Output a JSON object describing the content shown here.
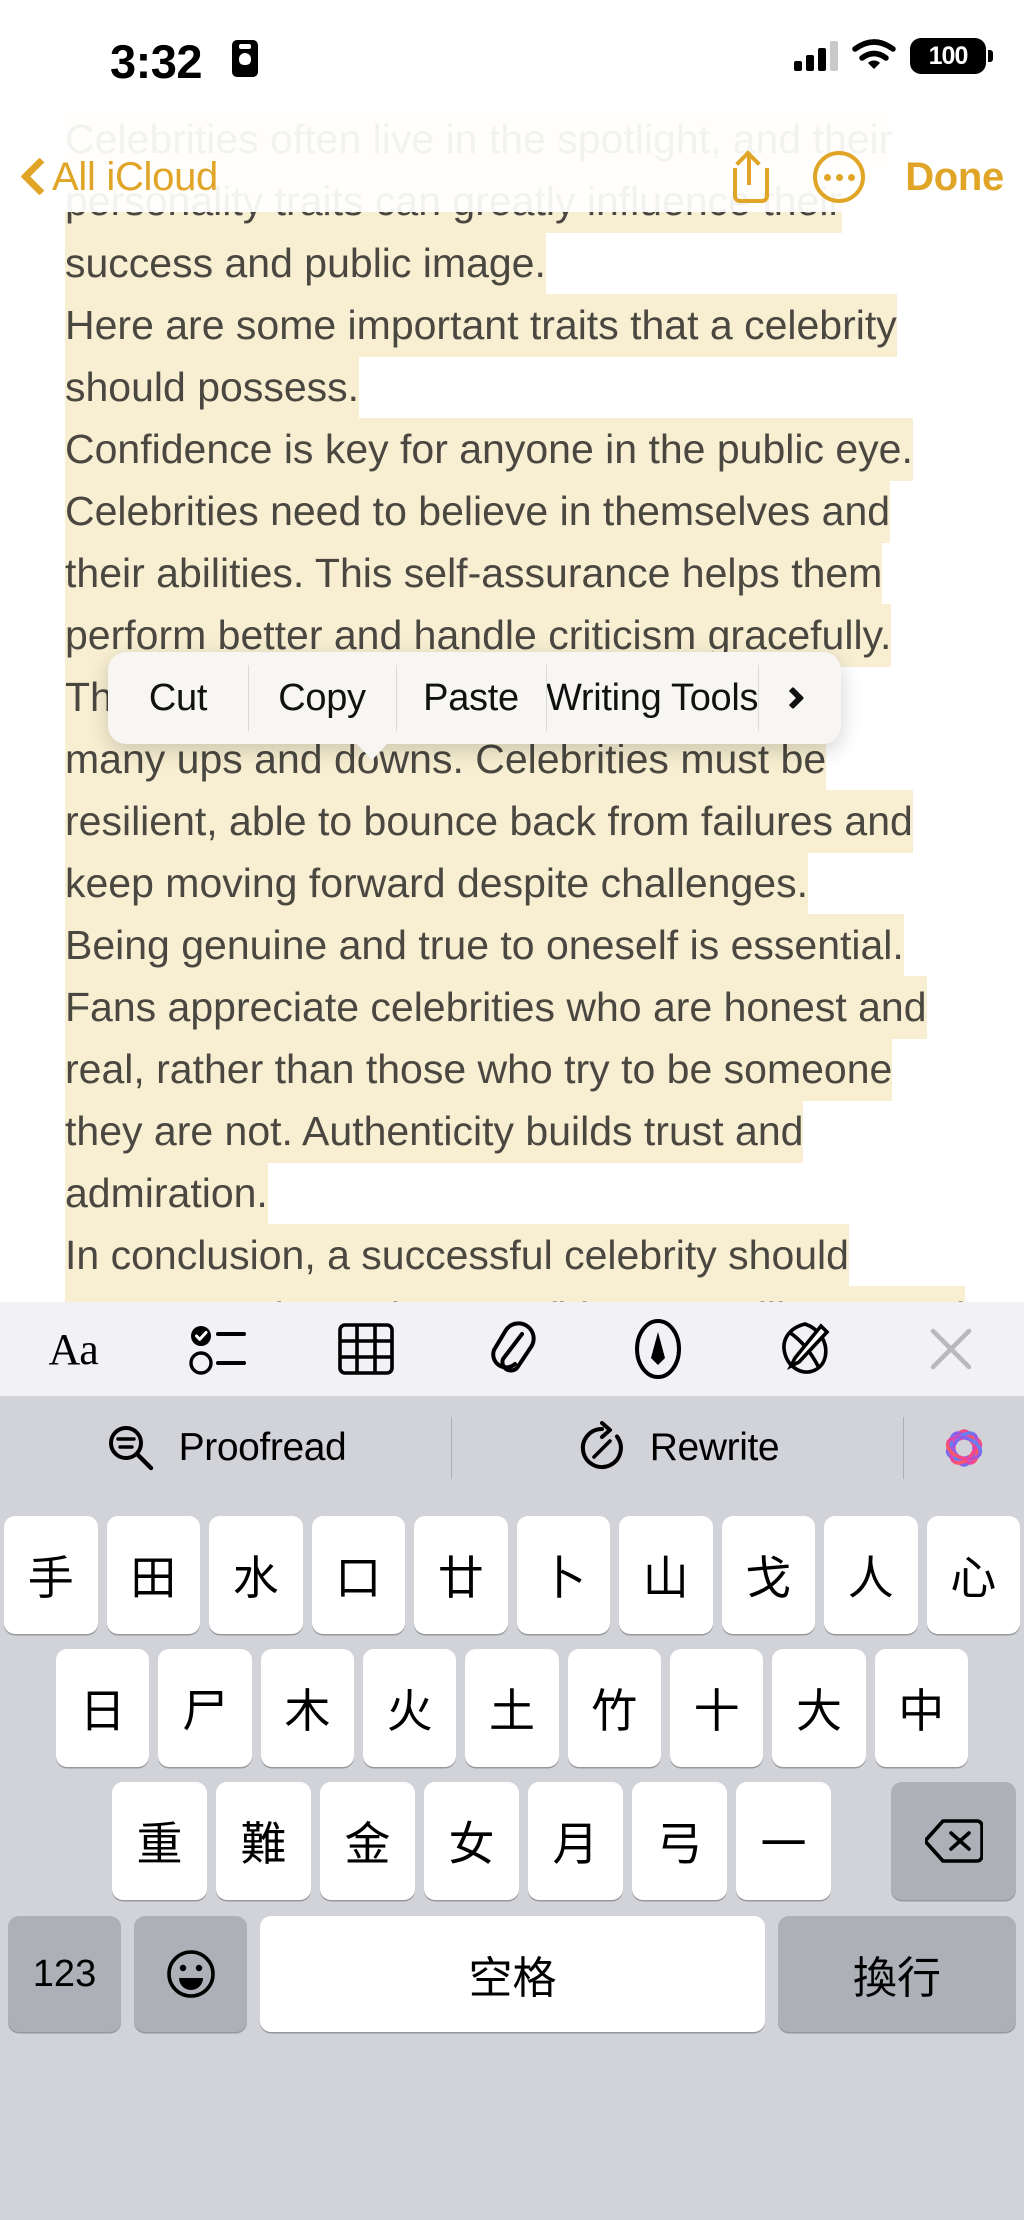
{
  "status_bar": {
    "time": "3:32",
    "screen_record_icon": "screen-recording-icon",
    "signal_icon": "cellular-signal-icon",
    "signal_bars": 3,
    "wifi_icon": "wifi-icon",
    "battery_percent": "100",
    "battery_icon": "battery-full-icon"
  },
  "nav_bar": {
    "back_icon": "chevron-left-icon",
    "back_label": "All iCloud",
    "share_icon": "share-icon",
    "more_icon": "more-ellipsis-icon",
    "done_label": "Done",
    "accent_color": "#e0a526"
  },
  "note": {
    "background_color": "#ffffff",
    "selection_highlight_color": "#f8efd2",
    "text_color": "#4a4741",
    "lines": [
      "Celebrities often live in the spotlight, and their",
      "personality traits can greatly influence their",
      "success and public image.",
      "Here are some important traits that a celebrity",
      "should possess.",
      "Confidence is key for anyone in the public eye.",
      "Celebrities need to believe in themselves and",
      "their abilities. This self-assurance helps them",
      "perform better and handle criticism gracefully.",
      "The entertainment industry is tough with",
      "many ups and downs. Celebrities must be",
      "resilient, able to bounce back from failures and",
      "keep moving forward despite challenges.",
      "Being genuine and true to oneself is essential.",
      "Fans appreciate celebrities who are honest and",
      "real, rather than those who try to be someone",
      "they are not. Authenticity builds trust and",
      "admiration.",
      "In conclusion, a successful celebrity should",
      "possess traits such as confidence, resilience, and"
    ]
  },
  "context_menu": {
    "items": [
      {
        "label": "Cut",
        "name": "cut"
      },
      {
        "label": "Copy",
        "name": "copy"
      },
      {
        "label": "Paste",
        "name": "paste"
      },
      {
        "label": "Writing Tools",
        "name": "writing-tools"
      }
    ],
    "more_arrow_icon": "chevron-right-icon",
    "background_color": "#f7f6f2"
  },
  "format_toolbar": {
    "background_color": "#f2f1f6",
    "items": [
      {
        "name": "text-format-icon",
        "label": "Aa"
      },
      {
        "name": "checklist-icon",
        "label": ""
      },
      {
        "name": "table-icon",
        "label": ""
      },
      {
        "name": "attachment-paperclip-icon",
        "label": ""
      },
      {
        "name": "markup-pen-icon",
        "label": ""
      },
      {
        "name": "apple-intelligence-icon",
        "label": ""
      },
      {
        "name": "close-icon",
        "label": ""
      }
    ]
  },
  "ai_bar": {
    "background_color": "#d2d3d8",
    "proofread_icon": "proofread-magnifier-icon",
    "proofread_label": "Proofread",
    "rewrite_icon": "rewrite-circle-icon",
    "rewrite_label": "Rewrite",
    "sparkle_icon": "apple-intelligence-sparkle-icon"
  },
  "keyboard": {
    "type": "cangjie-chinese",
    "background_color": "#d2d3d8",
    "key_color": "#ffffff",
    "modifier_key_color": "#aeb0b8",
    "row1": [
      "手",
      "田",
      "水",
      "口",
      "廿",
      "卜",
      "山",
      "戈",
      "人",
      "心"
    ],
    "row2": [
      "日",
      "尸",
      "木",
      "火",
      "土",
      "竹",
      "十",
      "大",
      "中"
    ],
    "row3": [
      "重",
      "難",
      "金",
      "女",
      "月",
      "弓",
      "一"
    ],
    "backspace_icon": "backspace-delete-icon",
    "numeric_label": "123",
    "emoji_icon": "emoji-smiley-icon",
    "space_label": "空格",
    "return_label": "換行",
    "globe_icon": "globe-language-icon",
    "mic_icon": "microphone-dictation-icon"
  }
}
